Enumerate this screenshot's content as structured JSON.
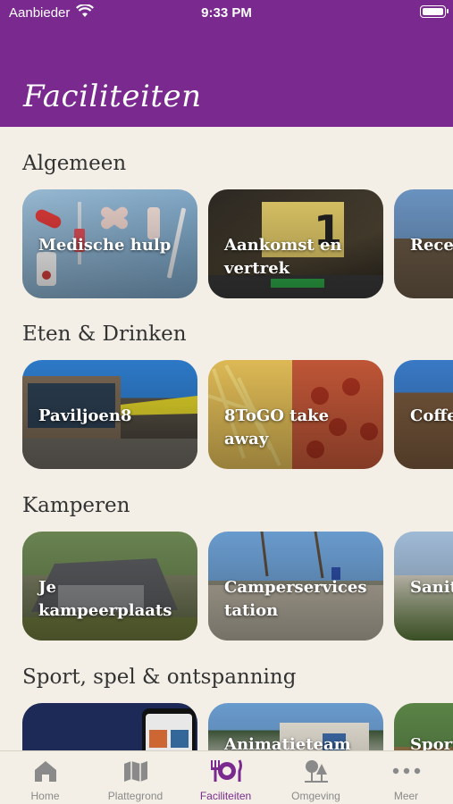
{
  "status": {
    "carrier": "Aanbieder",
    "time": "9:33 PM"
  },
  "header": {
    "title": "Faciliteiten"
  },
  "sections": [
    {
      "title": "Algemeen",
      "cards": [
        {
          "label": "Medische hulp"
        },
        {
          "label": "Aankomst en vertrek"
        },
        {
          "label": "Recep"
        }
      ]
    },
    {
      "title": "Eten & Drinken",
      "cards": [
        {
          "label": "Paviljoen8"
        },
        {
          "label": "8ToGO take away"
        },
        {
          "label": "Coffe"
        }
      ]
    },
    {
      "title": "Kamperen",
      "cards": [
        {
          "label": "Je kampeerplaats"
        },
        {
          "label": "Camperservices tation"
        },
        {
          "label": "Sanit wass"
        }
      ]
    },
    {
      "title": "Sport, spel & ontspanning",
      "cards": [
        {
          "label": ""
        },
        {
          "label": "Animatieteam"
        },
        {
          "label": "Sport"
        }
      ]
    }
  ],
  "tabbar": {
    "active_color": "#7a2a8f",
    "items": [
      {
        "label": "Home",
        "icon": "house-icon"
      },
      {
        "label": "Plattegrond",
        "icon": "map-icon"
      },
      {
        "label": "Faciliteiten",
        "icon": "cutlery-plate-icon"
      },
      {
        "label": "Omgeving",
        "icon": "trees-icon"
      },
      {
        "label": "Meer",
        "icon": "more-dots-icon"
      }
    ]
  }
}
